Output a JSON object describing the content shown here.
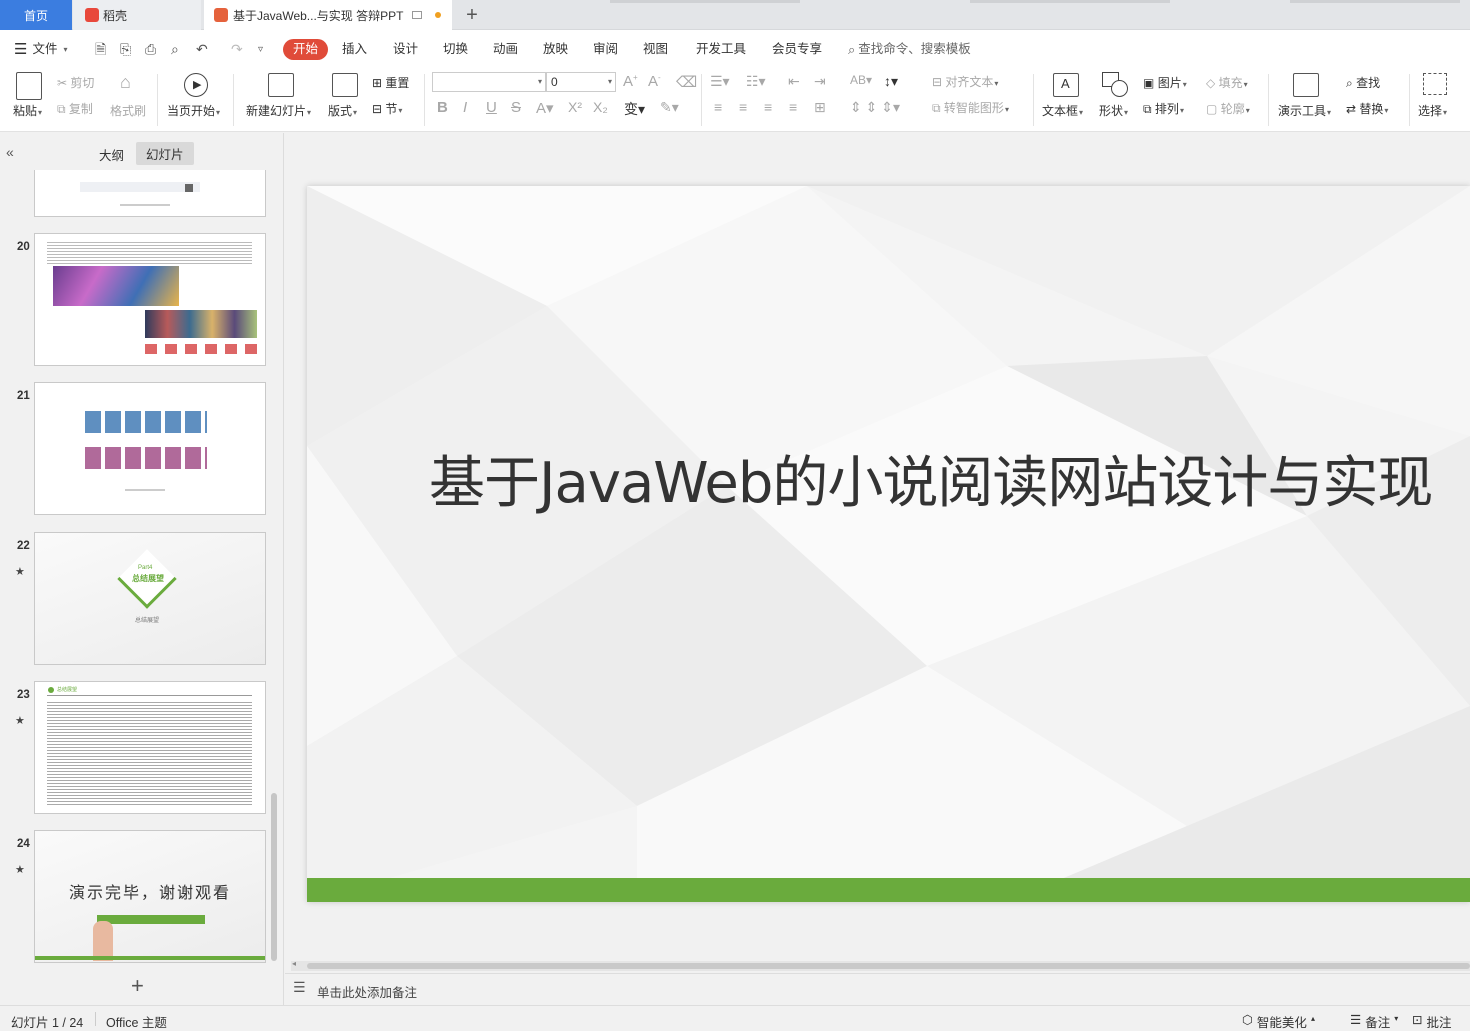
{
  "tabs": {
    "home": "首页",
    "daoke": "稻壳",
    "doc": "基于JavaWeb...与实现 答辩PPT",
    "new_tab": "+"
  },
  "menu": {
    "file": "文件",
    "items": [
      "开始",
      "插入",
      "设计",
      "切换",
      "动画",
      "放映",
      "审阅",
      "视图",
      "开发工具",
      "会员专享"
    ],
    "search": "查找命令、搜索模板"
  },
  "ribbon": {
    "paste": "粘贴",
    "cut": "剪切",
    "copy": "复制",
    "format_painter": "格式刷",
    "from_current": "当页开始",
    "new_slide": "新建幻灯片",
    "layout": "版式",
    "reset": "重置",
    "section": "节",
    "font_size": "0",
    "align_text": "对齐文本",
    "smart_shape": "转智能图形",
    "textbox": "文本框",
    "shape": "形状",
    "picture": "图片",
    "arrange": "排列",
    "fill": "填充",
    "outline": "轮廓",
    "presenter_tools": "演示工具",
    "find": "查找",
    "replace": "替换",
    "select": "选择"
  },
  "panel": {
    "outline_tab": "大纲",
    "slides_tab": "幻灯片",
    "add_slide": "+",
    "slides": [
      {
        "num": "20"
      },
      {
        "num": "21"
      },
      {
        "num": "22",
        "part": "Part4",
        "title": "总结展望",
        "sub": "总结展望"
      },
      {
        "num": "23",
        "heading": "总结展望"
      },
      {
        "num": "24",
        "text": "演示完毕，谢谢观看"
      }
    ]
  },
  "slide": {
    "title": "基于JavaWeb的小说阅读网站设计与实现",
    "bar_color": "#6aab3d"
  },
  "notes": {
    "placeholder": "单击此处添加备注"
  },
  "status": {
    "slide_counter": "幻灯片 1 / 24",
    "theme": "Office 主题",
    "beautify": "智能美化",
    "notes": "备注",
    "comments": "批注"
  },
  "colors": {
    "accent_blue": "#3b7de0",
    "start_red": "#e04b39",
    "green": "#6aab3d"
  }
}
